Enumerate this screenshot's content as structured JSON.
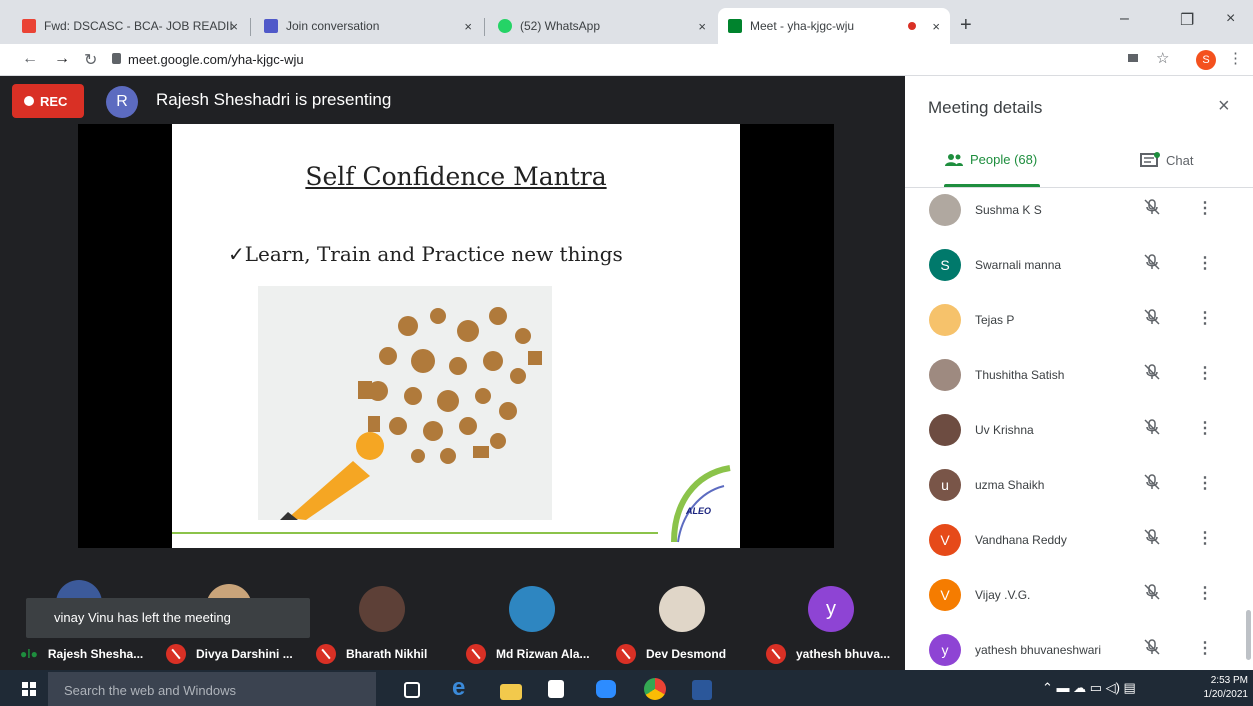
{
  "browser": {
    "tabs": [
      {
        "title": "Fwd: DSCASC - BCA- JOB READII",
        "favicon_color": "#ea4335"
      },
      {
        "title": "Join conversation",
        "favicon_color": "#5059c9"
      },
      {
        "title": "(52) WhatsApp",
        "favicon_color": "#25d366"
      },
      {
        "title": "Meet - yha-kjgc-wju",
        "favicon_color": "#00832d"
      }
    ],
    "close_glyph": "×",
    "new_tab_glyph": "+",
    "url": "meet.google.com/yha-kjgc-wju",
    "profile_initial": "S",
    "window_controls": [
      "–",
      "❐",
      "×"
    ]
  },
  "meeting": {
    "rec_label": "REC",
    "presenter_initial": "R",
    "presenting_text": "Rajesh Sheshadri is presenting",
    "slide": {
      "title": "Self Confidence Mantra",
      "bullet": "✓Learn, Train and Practice new things",
      "logo_text": "ALEO"
    },
    "toast": "vinay Vinu has left the meeting",
    "participants_bar": [
      {
        "name": "Rajesh Shesha...",
        "speaking": true
      },
      {
        "name": "Divya Darshini ...",
        "muted": true
      },
      {
        "name": "Bharath Nikhil",
        "muted": true
      },
      {
        "name": "Md Rizwan Ala...",
        "muted": true
      },
      {
        "name": "Dev Desmond",
        "muted": true
      },
      {
        "name": "yathesh bhuva...",
        "muted": true
      }
    ],
    "tile_y_initial": "y"
  },
  "panel": {
    "title": "Meeting details",
    "close_glyph": "×",
    "tab_people": "People (68)",
    "tab_chat": "Chat",
    "more_glyph": "⋮",
    "people": [
      {
        "name": "Sushma K S",
        "initial": "",
        "color": "#b0a8a0"
      },
      {
        "name": "Swarnali manna",
        "initial": "S",
        "color": "#00796b"
      },
      {
        "name": "Tejas P",
        "initial": "",
        "color": "#f6c26b"
      },
      {
        "name": "Thushitha Satish",
        "initial": "",
        "color": "#9e8a80"
      },
      {
        "name": "Uv Krishna",
        "initial": "",
        "color": "#6d4c41"
      },
      {
        "name": "uzma Shaikh",
        "initial": "u",
        "color": "#795548"
      },
      {
        "name": "Vandhana Reddy",
        "initial": "V",
        "color": "#e64a19"
      },
      {
        "name": "Vijay .V.G.",
        "initial": "V",
        "color": "#f57c00"
      },
      {
        "name": "yathesh bhuvaneshwari",
        "initial": "y",
        "color": "#8e44d4"
      }
    ]
  },
  "taskbar": {
    "search_placeholder": "Search the web and Windows",
    "time": "2:53 PM",
    "date": "1/20/2021"
  },
  "colors": {
    "accent_green": "#1e8e3e",
    "rec_red": "#d93025",
    "meet_bg": "#202124"
  }
}
